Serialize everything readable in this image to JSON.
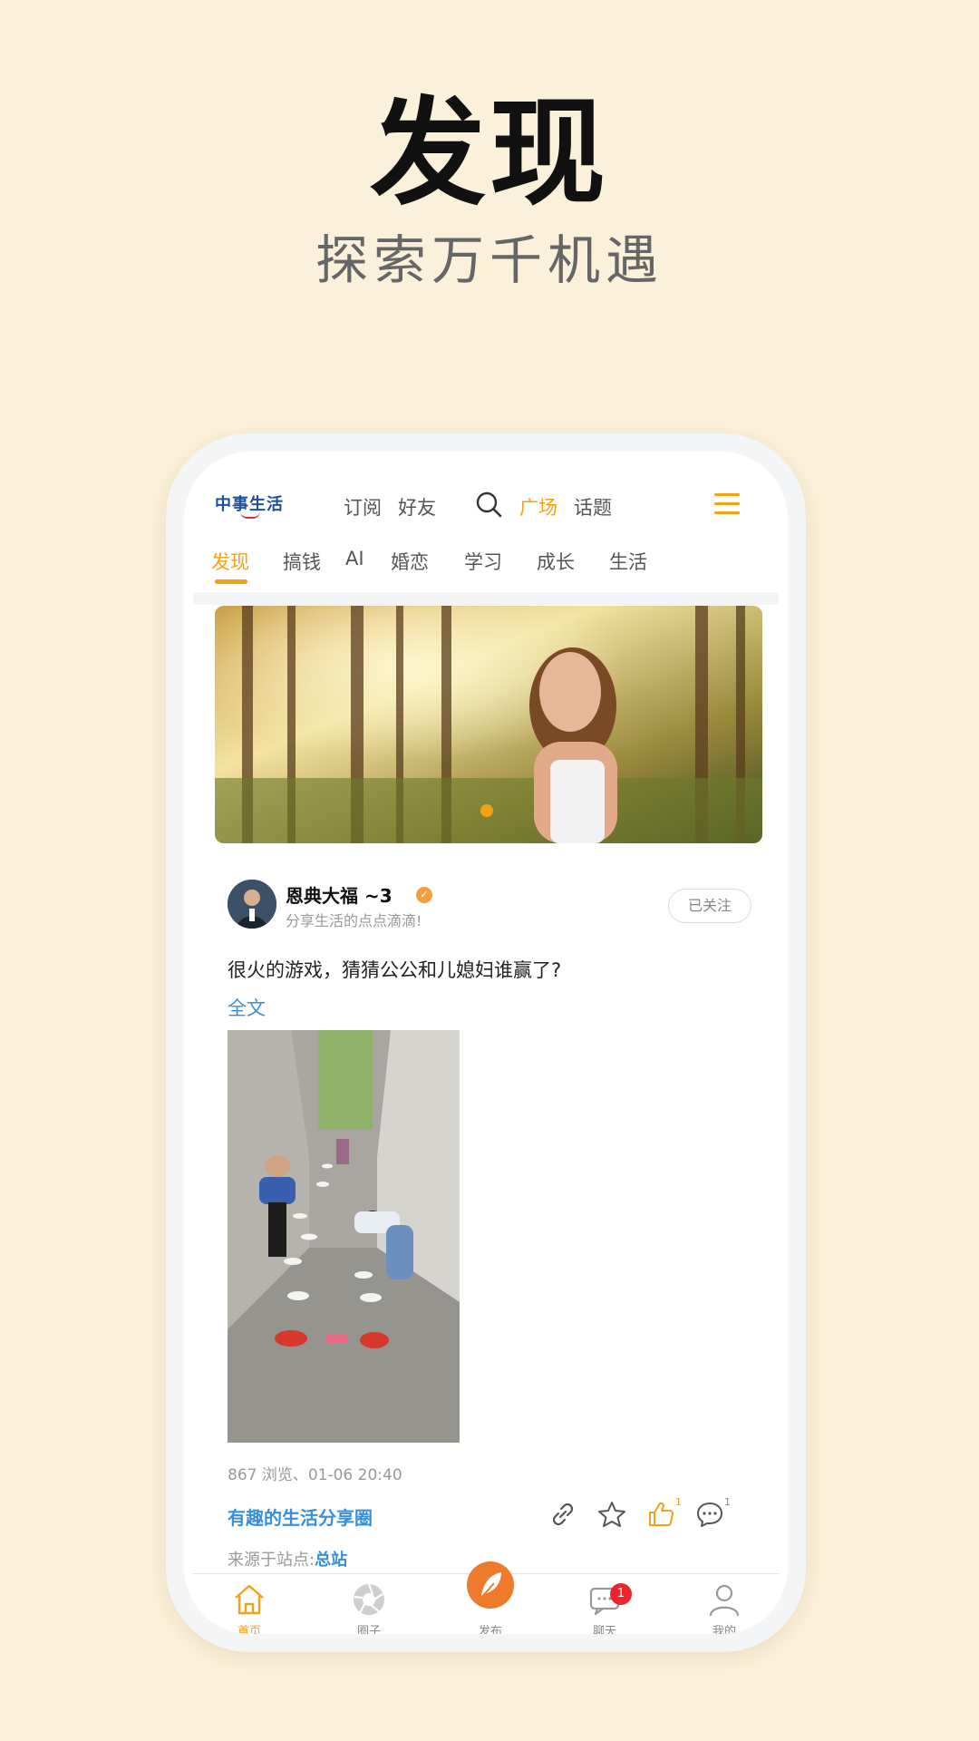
{
  "hero": {
    "title": "发现",
    "subtitle": "探索万千机遇"
  },
  "app": {
    "logo": "中事生活",
    "nav": [
      "订阅",
      "好友",
      "广场",
      "话题"
    ],
    "active_nav": "广场",
    "categories": [
      "发现",
      "搞钱",
      "AI",
      "婚恋",
      "学习",
      "成长",
      "生活"
    ],
    "active_category": "发现"
  },
  "post": {
    "user_name": "恩典大福 ~3",
    "signature": "分享生活的点点滴滴!",
    "follow_label": "已关注",
    "text": "很火的游戏，猜猜公公和儿媳妇谁赢了?",
    "full_text_link": "全文",
    "stats": "867 浏览、01-06 20:40",
    "circle": "有趣的生活分享圈",
    "like_count": "1",
    "comment_count": "1",
    "source_prefix": "来源于站点:",
    "source_site": "总站"
  },
  "tabbar": {
    "items": [
      "首页",
      "圈子",
      "发布",
      "聊天",
      "我的"
    ],
    "active": "首页",
    "chat_badge": "1"
  },
  "colors": {
    "accent": "#f2a217",
    "link": "#3a8fd9",
    "background": "#fbf0d9"
  },
  "icons": [
    "search-icon",
    "menu-icon",
    "link-icon",
    "star-icon",
    "thumb-up-icon",
    "comment-icon",
    "home-icon",
    "circle-icon",
    "feather-icon",
    "chat-icon",
    "user-icon"
  ]
}
